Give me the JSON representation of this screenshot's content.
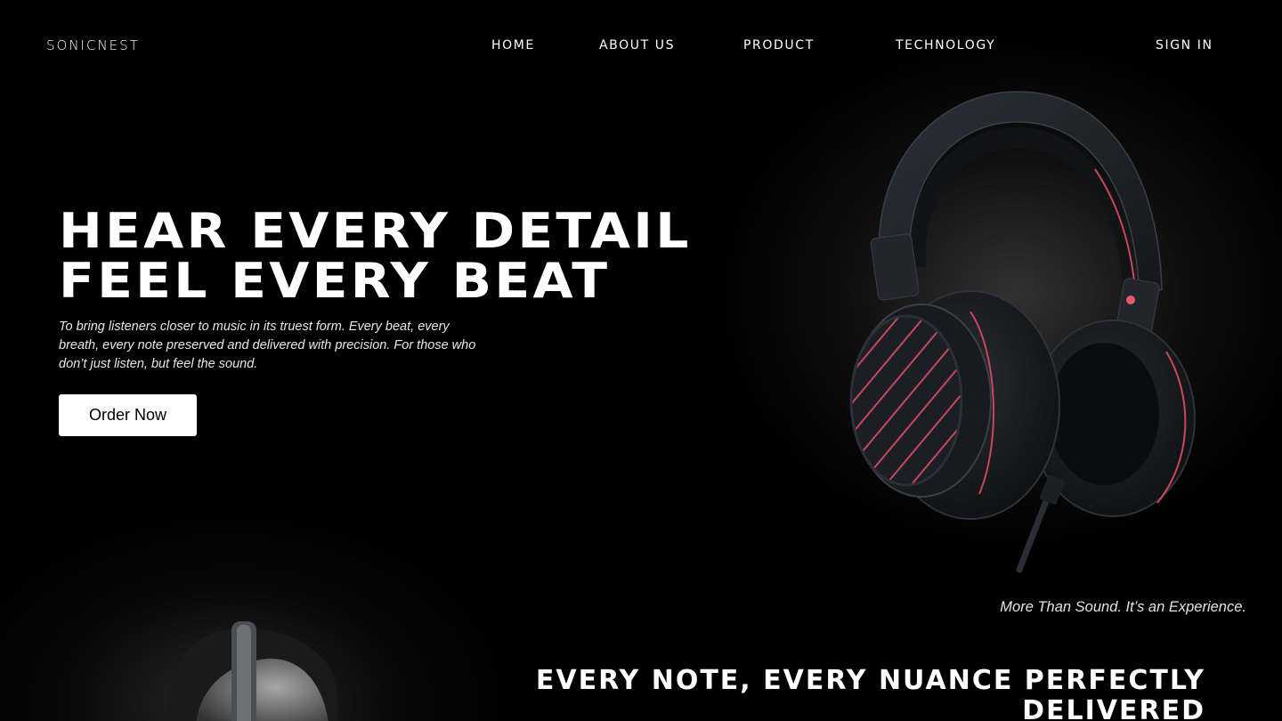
{
  "nav": {
    "brand": "SONICNEST",
    "links": [
      {
        "label": "HOME"
      },
      {
        "label": "ABOUT US"
      },
      {
        "label": "PRODUCT"
      },
      {
        "label": "TECHNOLOGY"
      }
    ],
    "sign_in": "SIGN IN"
  },
  "hero": {
    "title_line1": "HEAR EVERY DETAIL",
    "title_line2": "FEEL EVERY BEAT",
    "description": "To bring listeners closer to music in its truest form. Every beat, every breath, every note preserved and delivered with precision. For those who don’t just listen, but feel the sound.",
    "cta_label": "Order Now",
    "product_image": "headphones-product",
    "tagline": "More Than Sound. It’s an Experience."
  },
  "section2": {
    "title": "EVERY NOTE, EVERY NUANCE PERFECTLY DELIVERED",
    "image": "person-wearing-headphones"
  },
  "colors": {
    "background": "#000000",
    "text": "#ffffff",
    "button_bg": "#ffffff",
    "button_text": "#000000",
    "accent_stripe": "#d9485a"
  }
}
